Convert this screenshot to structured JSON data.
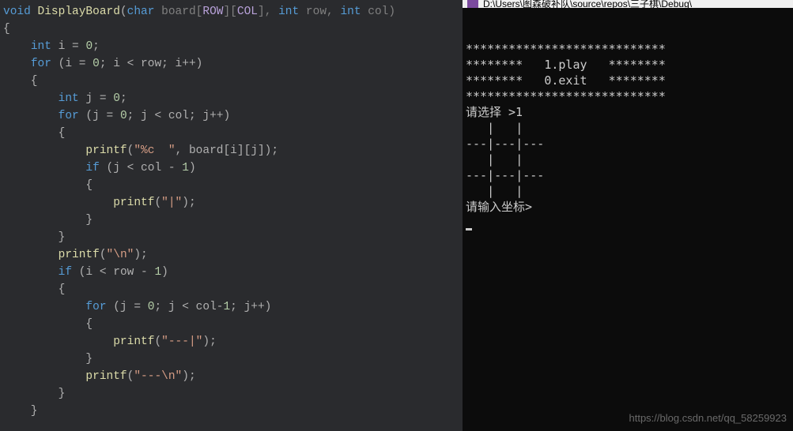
{
  "editor": {
    "lines": [
      {
        "segments": [
          {
            "t": "void ",
            "c": "kw"
          },
          {
            "t": "DisplayBoard",
            "c": "fn"
          },
          {
            "t": "(",
            "c": "punc"
          },
          {
            "t": "char",
            "c": "type"
          },
          {
            "t": " board[",
            "c": "param"
          },
          {
            "t": "ROW",
            "c": "macro"
          },
          {
            "t": "][",
            "c": "param"
          },
          {
            "t": "COL",
            "c": "macro"
          },
          {
            "t": "], ",
            "c": "param"
          },
          {
            "t": "int",
            "c": "type"
          },
          {
            "t": " row, ",
            "c": "param"
          },
          {
            "t": "int",
            "c": "type"
          },
          {
            "t": " col)",
            "c": "param"
          }
        ]
      },
      {
        "segments": [
          {
            "t": "{",
            "c": "brace"
          }
        ]
      },
      {
        "segments": [
          {
            "t": "    ",
            "c": "guide"
          },
          {
            "t": "int",
            "c": "type"
          },
          {
            "t": " i = ",
            "c": "punc"
          },
          {
            "t": "0",
            "c": "num"
          },
          {
            "t": ";",
            "c": "punc"
          }
        ]
      },
      {
        "segments": [
          {
            "t": "    ",
            "c": "guide"
          },
          {
            "t": "for",
            "c": "kw"
          },
          {
            "t": " (i = ",
            "c": "punc"
          },
          {
            "t": "0",
            "c": "num"
          },
          {
            "t": "; i < row; i++)",
            "c": "punc"
          }
        ]
      },
      {
        "segments": [
          {
            "t": "    {",
            "c": "brace"
          }
        ]
      },
      {
        "segments": [
          {
            "t": "        ",
            "c": "guide"
          },
          {
            "t": "int",
            "c": "type"
          },
          {
            "t": " j = ",
            "c": "punc"
          },
          {
            "t": "0",
            "c": "num"
          },
          {
            "t": ";",
            "c": "punc"
          }
        ]
      },
      {
        "segments": [
          {
            "t": "        ",
            "c": "guide"
          },
          {
            "t": "for",
            "c": "kw"
          },
          {
            "t": " (j = ",
            "c": "punc"
          },
          {
            "t": "0",
            "c": "num"
          },
          {
            "t": "; j < col; j++)",
            "c": "punc"
          }
        ]
      },
      {
        "segments": [
          {
            "t": "        {",
            "c": "brace"
          }
        ]
      },
      {
        "segments": [
          {
            "t": "            ",
            "c": "guide"
          },
          {
            "t": "printf",
            "c": "fn"
          },
          {
            "t": "(",
            "c": "punc"
          },
          {
            "t": "\"%c  \"",
            "c": "str"
          },
          {
            "t": ", board[i][j]);",
            "c": "punc"
          }
        ]
      },
      {
        "segments": [
          {
            "t": "            ",
            "c": "guide"
          },
          {
            "t": "if",
            "c": "kw"
          },
          {
            "t": " (j < col - ",
            "c": "punc"
          },
          {
            "t": "1",
            "c": "num"
          },
          {
            "t": ")",
            "c": "punc"
          }
        ]
      },
      {
        "segments": [
          {
            "t": "            {",
            "c": "brace"
          }
        ]
      },
      {
        "segments": [
          {
            "t": "                ",
            "c": "guide"
          },
          {
            "t": "printf",
            "c": "fn"
          },
          {
            "t": "(",
            "c": "punc"
          },
          {
            "t": "\"|\"",
            "c": "str"
          },
          {
            "t": ");",
            "c": "punc"
          }
        ]
      },
      {
        "segments": [
          {
            "t": "            }",
            "c": "brace"
          }
        ]
      },
      {
        "segments": [
          {
            "t": "        }",
            "c": "brace"
          }
        ]
      },
      {
        "segments": [
          {
            "t": "        ",
            "c": "guide"
          },
          {
            "t": "printf",
            "c": "fn"
          },
          {
            "t": "(",
            "c": "punc"
          },
          {
            "t": "\"\\n\"",
            "c": "str"
          },
          {
            "t": ");",
            "c": "punc"
          }
        ]
      },
      {
        "segments": [
          {
            "t": "        ",
            "c": "guide"
          },
          {
            "t": "if",
            "c": "kw"
          },
          {
            "t": " (i < row - ",
            "c": "punc"
          },
          {
            "t": "1",
            "c": "num"
          },
          {
            "t": ")",
            "c": "punc"
          }
        ]
      },
      {
        "segments": [
          {
            "t": "        {",
            "c": "brace"
          }
        ]
      },
      {
        "segments": [
          {
            "t": "            ",
            "c": "guide"
          },
          {
            "t": "for",
            "c": "kw"
          },
          {
            "t": " (j = ",
            "c": "punc"
          },
          {
            "t": "0",
            "c": "num"
          },
          {
            "t": "; j < col-",
            "c": "punc"
          },
          {
            "t": "1",
            "c": "num"
          },
          {
            "t": "; j++)",
            "c": "punc"
          }
        ]
      },
      {
        "segments": [
          {
            "t": "            {",
            "c": "brace"
          }
        ]
      },
      {
        "segments": [
          {
            "t": "                ",
            "c": "guide"
          },
          {
            "t": "printf",
            "c": "fn"
          },
          {
            "t": "(",
            "c": "punc"
          },
          {
            "t": "\"---|\"",
            "c": "str"
          },
          {
            "t": ");",
            "c": "punc"
          }
        ]
      },
      {
        "segments": [
          {
            "t": "            }",
            "c": "brace"
          }
        ]
      },
      {
        "segments": [
          {
            "t": "            ",
            "c": "guide"
          },
          {
            "t": "printf",
            "c": "fn"
          },
          {
            "t": "(",
            "c": "punc"
          },
          {
            "t": "\"---\\n\"",
            "c": "str"
          },
          {
            "t": ");",
            "c": "punc"
          }
        ]
      },
      {
        "segments": [
          {
            "t": "        }",
            "c": "brace"
          }
        ]
      },
      {
        "segments": [
          {
            "t": "    }",
            "c": "brace"
          }
        ]
      }
    ]
  },
  "console": {
    "title": "D:\\Users\\图森破补队\\source\\repos\\三子棋\\Debug\\",
    "lines": [
      "****************************",
      "********   1.play   ********",
      "********   0.exit   ********",
      "****************************",
      "请选择 >1",
      "   |   |   ",
      "---|---|---",
      "   |   |   ",
      "---|---|---",
      "   |   |   ",
      "请输入坐标>"
    ]
  },
  "watermark": "https://blog.csdn.net/qq_58259923"
}
